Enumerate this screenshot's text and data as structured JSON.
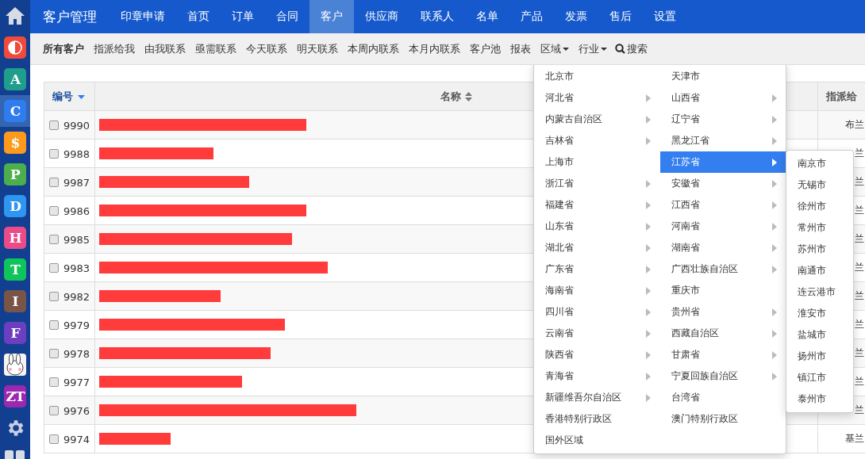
{
  "sidebar": [
    {
      "kind": "home",
      "selected": false
    },
    {
      "kind": "half-tile",
      "color": "#f04a3c",
      "selected": false
    },
    {
      "kind": "tile",
      "letter": "A",
      "color": "#1f9e8c",
      "selected": false
    },
    {
      "kind": "tile",
      "letter": "C",
      "color": "#2f7cf0",
      "selected": true
    },
    {
      "kind": "tile",
      "letter": "$",
      "color": "#fb9a1c",
      "selected": false
    },
    {
      "kind": "tile",
      "letter": "P",
      "color": "#4cae4c",
      "selected": false
    },
    {
      "kind": "tile",
      "letter": "D",
      "color": "#2f95f0",
      "selected": false
    },
    {
      "kind": "tile",
      "letter": "H",
      "color": "#ea4c89",
      "selected": false
    },
    {
      "kind": "tile",
      "letter": "T",
      "color": "#10c45c",
      "selected": false
    },
    {
      "kind": "tile",
      "letter": "I",
      "color": "#795548",
      "selected": false
    },
    {
      "kind": "tile",
      "letter": "F",
      "color": "#6b3fbf",
      "selected": false
    },
    {
      "kind": "picture",
      "selected": false
    },
    {
      "kind": "tile",
      "letter": "ZT",
      "color": "#9c27b0",
      "selected": false
    },
    {
      "kind": "settings",
      "selected": false
    },
    {
      "kind": "grid",
      "selected": false
    }
  ],
  "nav": {
    "title": "客户管理",
    "tabs": [
      {
        "label": "印章申请",
        "selected": false
      },
      {
        "label": "首页",
        "selected": false
      },
      {
        "label": "订单",
        "selected": false
      },
      {
        "label": "合同",
        "selected": false
      },
      {
        "label": "客户",
        "selected": true
      },
      {
        "label": "供应商",
        "selected": false
      },
      {
        "label": "联系人",
        "selected": false
      },
      {
        "label": "名单",
        "selected": false
      },
      {
        "label": "产品",
        "selected": false
      },
      {
        "label": "发票",
        "selected": false
      },
      {
        "label": "售后",
        "selected": false
      },
      {
        "label": "设置",
        "selected": false
      }
    ]
  },
  "subnav": [
    {
      "label": "所有客户",
      "kind": "link",
      "selected": true
    },
    {
      "label": "指派给我",
      "kind": "link",
      "selected": false
    },
    {
      "label": "由我联系",
      "kind": "link",
      "selected": false
    },
    {
      "label": "亟需联系",
      "kind": "link",
      "selected": false
    },
    {
      "label": "今天联系",
      "kind": "link",
      "selected": false
    },
    {
      "label": "明天联系",
      "kind": "link",
      "selected": false
    },
    {
      "label": "本周内联系",
      "kind": "link",
      "selected": false
    },
    {
      "label": "本月内联系",
      "kind": "link",
      "selected": false
    },
    {
      "label": "客户池",
      "kind": "link",
      "selected": false
    },
    {
      "label": "报表",
      "kind": "link",
      "selected": false
    },
    {
      "label": "区域",
      "kind": "dropdown",
      "selected": false
    },
    {
      "label": "行业",
      "kind": "dropdown",
      "selected": false
    },
    {
      "label": "搜索",
      "kind": "search",
      "selected": false
    }
  ],
  "table": {
    "columns": [
      {
        "label": "编号",
        "sorted": true,
        "sortable": true
      },
      {
        "label": "名称",
        "sorted": false,
        "sortable": true
      },
      {
        "label": "指派给"
      }
    ],
    "rows": [
      {
        "id": "9990",
        "checked": false,
        "level": 0.29,
        "assigned": "布兰"
      },
      {
        "id": "9988",
        "checked": false,
        "level": 0.16,
        "assigned": "兰"
      },
      {
        "id": "9987",
        "checked": false,
        "level": 0.21,
        "assigned": "兰"
      },
      {
        "id": "9986",
        "checked": false,
        "level": 0.29,
        "assigned": "兰"
      },
      {
        "id": "9985",
        "checked": false,
        "level": 0.27,
        "assigned": "兰"
      },
      {
        "id": "9983",
        "checked": false,
        "level": 0.32,
        "assigned": "兰"
      },
      {
        "id": "9982",
        "checked": false,
        "level": 0.17,
        "assigned": "兰"
      },
      {
        "id": "9979",
        "checked": false,
        "level": 0.26,
        "assigned": "兰"
      },
      {
        "id": "9978",
        "checked": false,
        "level": 0.24,
        "assigned": "兰"
      },
      {
        "id": "9977",
        "checked": false,
        "level": 0.2,
        "assigned": "兰"
      },
      {
        "id": "9976",
        "checked": false,
        "level": 0.36,
        "assigned": "兰"
      },
      {
        "id": "9974",
        "checked": false,
        "level": 0.1,
        "assigned": "基兰"
      }
    ]
  },
  "region_menu": {
    "items": [
      {
        "label": "北京市",
        "has_children": false,
        "selected": false
      },
      {
        "label": "天津市",
        "has_children": false,
        "selected": false
      },
      {
        "label": "河北省",
        "has_children": true,
        "selected": false
      },
      {
        "label": "山西省",
        "has_children": true,
        "selected": false
      },
      {
        "label": "内蒙古自治区",
        "has_children": true,
        "selected": false
      },
      {
        "label": "辽宁省",
        "has_children": true,
        "selected": false
      },
      {
        "label": "吉林省",
        "has_children": true,
        "selected": false
      },
      {
        "label": "黑龙江省",
        "has_children": true,
        "selected": false
      },
      {
        "label": "上海市",
        "has_children": false,
        "selected": false
      },
      {
        "label": "江苏省",
        "has_children": true,
        "selected": true
      },
      {
        "label": "浙江省",
        "has_children": true,
        "selected": false
      },
      {
        "label": "安徽省",
        "has_children": true,
        "selected": false
      },
      {
        "label": "福建省",
        "has_children": true,
        "selected": false
      },
      {
        "label": "江西省",
        "has_children": true,
        "selected": false
      },
      {
        "label": "山东省",
        "has_children": true,
        "selected": false
      },
      {
        "label": "河南省",
        "has_children": true,
        "selected": false
      },
      {
        "label": "湖北省",
        "has_children": true,
        "selected": false
      },
      {
        "label": "湖南省",
        "has_children": true,
        "selected": false
      },
      {
        "label": "广东省",
        "has_children": true,
        "selected": false
      },
      {
        "label": "广西壮族自治区",
        "has_children": true,
        "selected": false
      },
      {
        "label": "海南省",
        "has_children": true,
        "selected": false
      },
      {
        "label": "重庆市",
        "has_children": false,
        "selected": false
      },
      {
        "label": "四川省",
        "has_children": true,
        "selected": false
      },
      {
        "label": "贵州省",
        "has_children": true,
        "selected": false
      },
      {
        "label": "云南省",
        "has_children": true,
        "selected": false
      },
      {
        "label": "西藏自治区",
        "has_children": true,
        "selected": false
      },
      {
        "label": "陕西省",
        "has_children": true,
        "selected": false
      },
      {
        "label": "甘肃省",
        "has_children": true,
        "selected": false
      },
      {
        "label": "青海省",
        "has_children": true,
        "selected": false
      },
      {
        "label": "宁夏回族自治区",
        "has_children": true,
        "selected": false
      },
      {
        "label": "新疆维吾尔自治区",
        "has_children": true,
        "selected": false
      },
      {
        "label": "台湾省",
        "has_children": false,
        "selected": false
      },
      {
        "label": "香港特别行政区",
        "has_children": false,
        "selected": false
      },
      {
        "label": "澳门特别行政区",
        "has_children": false,
        "selected": false
      },
      {
        "label": "国外区域",
        "has_children": false,
        "selected": false
      }
    ],
    "submenu": [
      "南京市",
      "无锡市",
      "徐州市",
      "常州市",
      "苏州市",
      "南通市",
      "连云港市",
      "淮安市",
      "盐城市",
      "扬州市",
      "镇江市",
      "泰州市"
    ]
  }
}
